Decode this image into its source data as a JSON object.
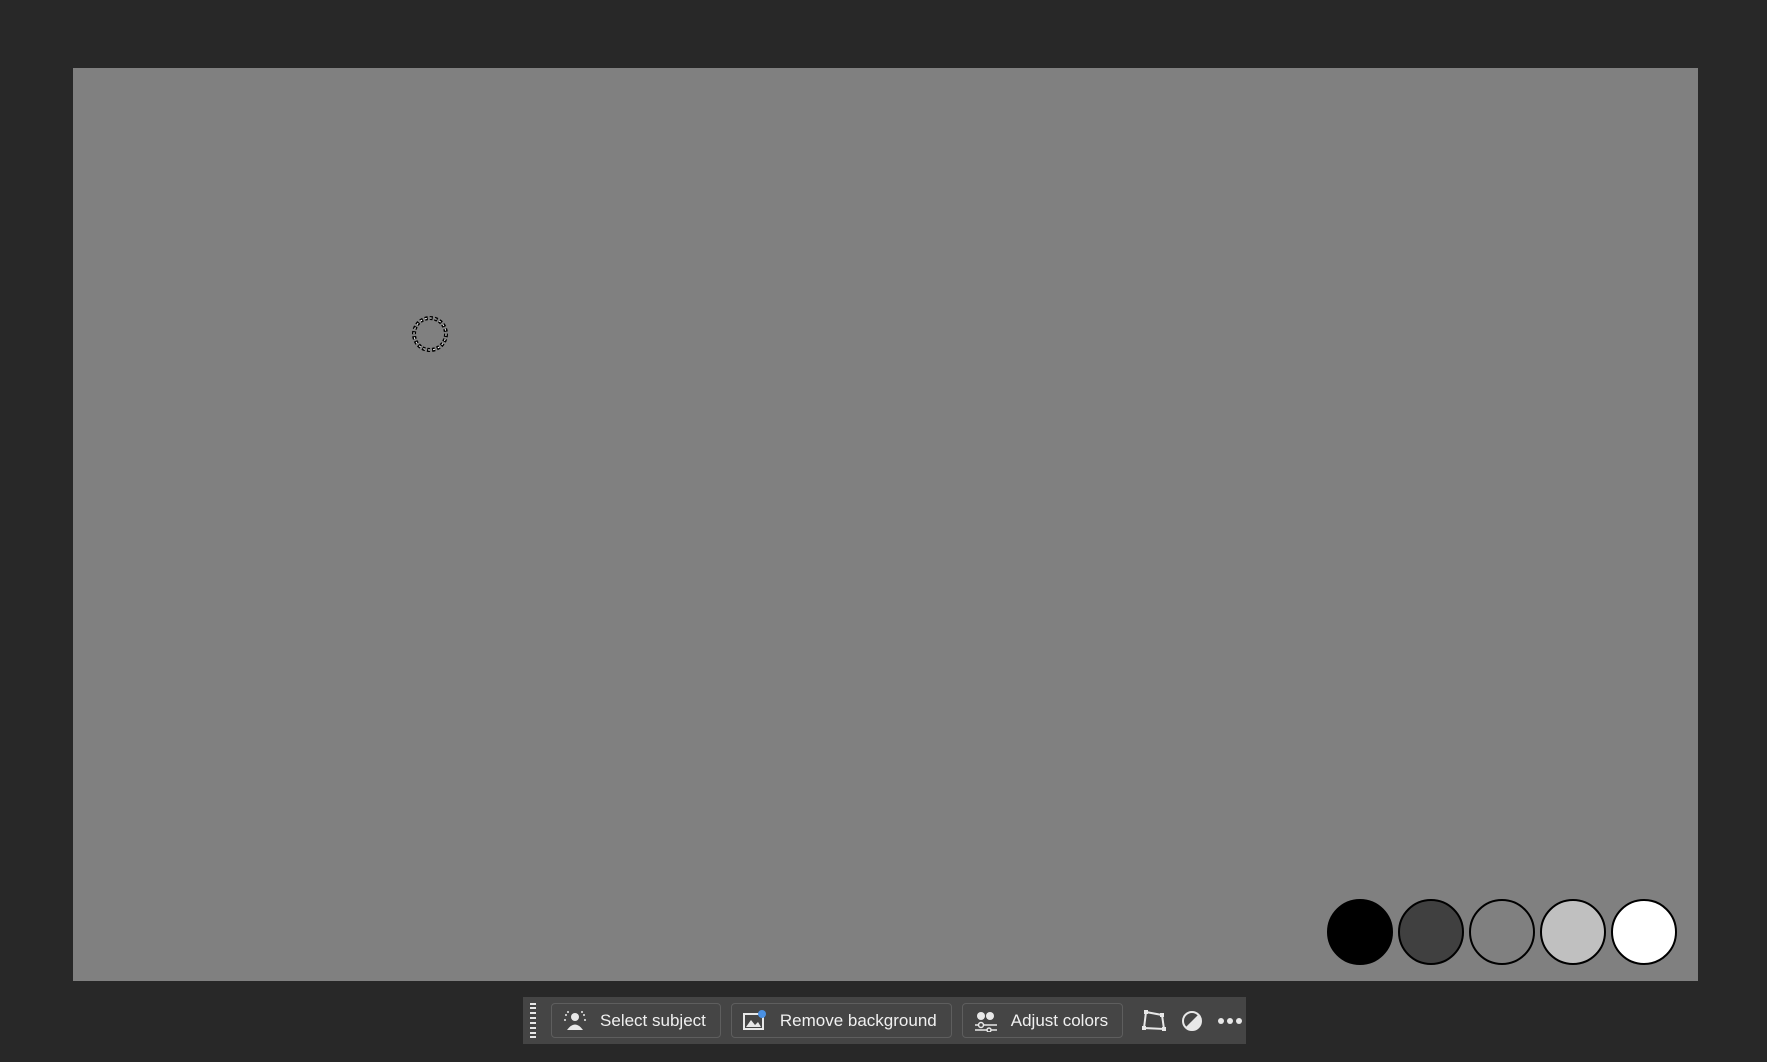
{
  "canvas": {
    "background": "#808080"
  },
  "workspace_background": "#282828",
  "swatches": [
    {
      "color": "#000000"
    },
    {
      "color": "#404040"
    },
    {
      "color": "#808080"
    },
    {
      "color": "#c0c0c0"
    },
    {
      "color": "#ffffff"
    }
  ],
  "taskbar": {
    "select_subject_label": "Select subject",
    "remove_background_label": "Remove background",
    "adjust_colors_label": "Adjust colors",
    "icons": [
      "select-subject-icon",
      "remove-background-icon",
      "adjust-colors-icon",
      "transform-icon",
      "contrast-icon",
      "more-icon"
    ]
  }
}
